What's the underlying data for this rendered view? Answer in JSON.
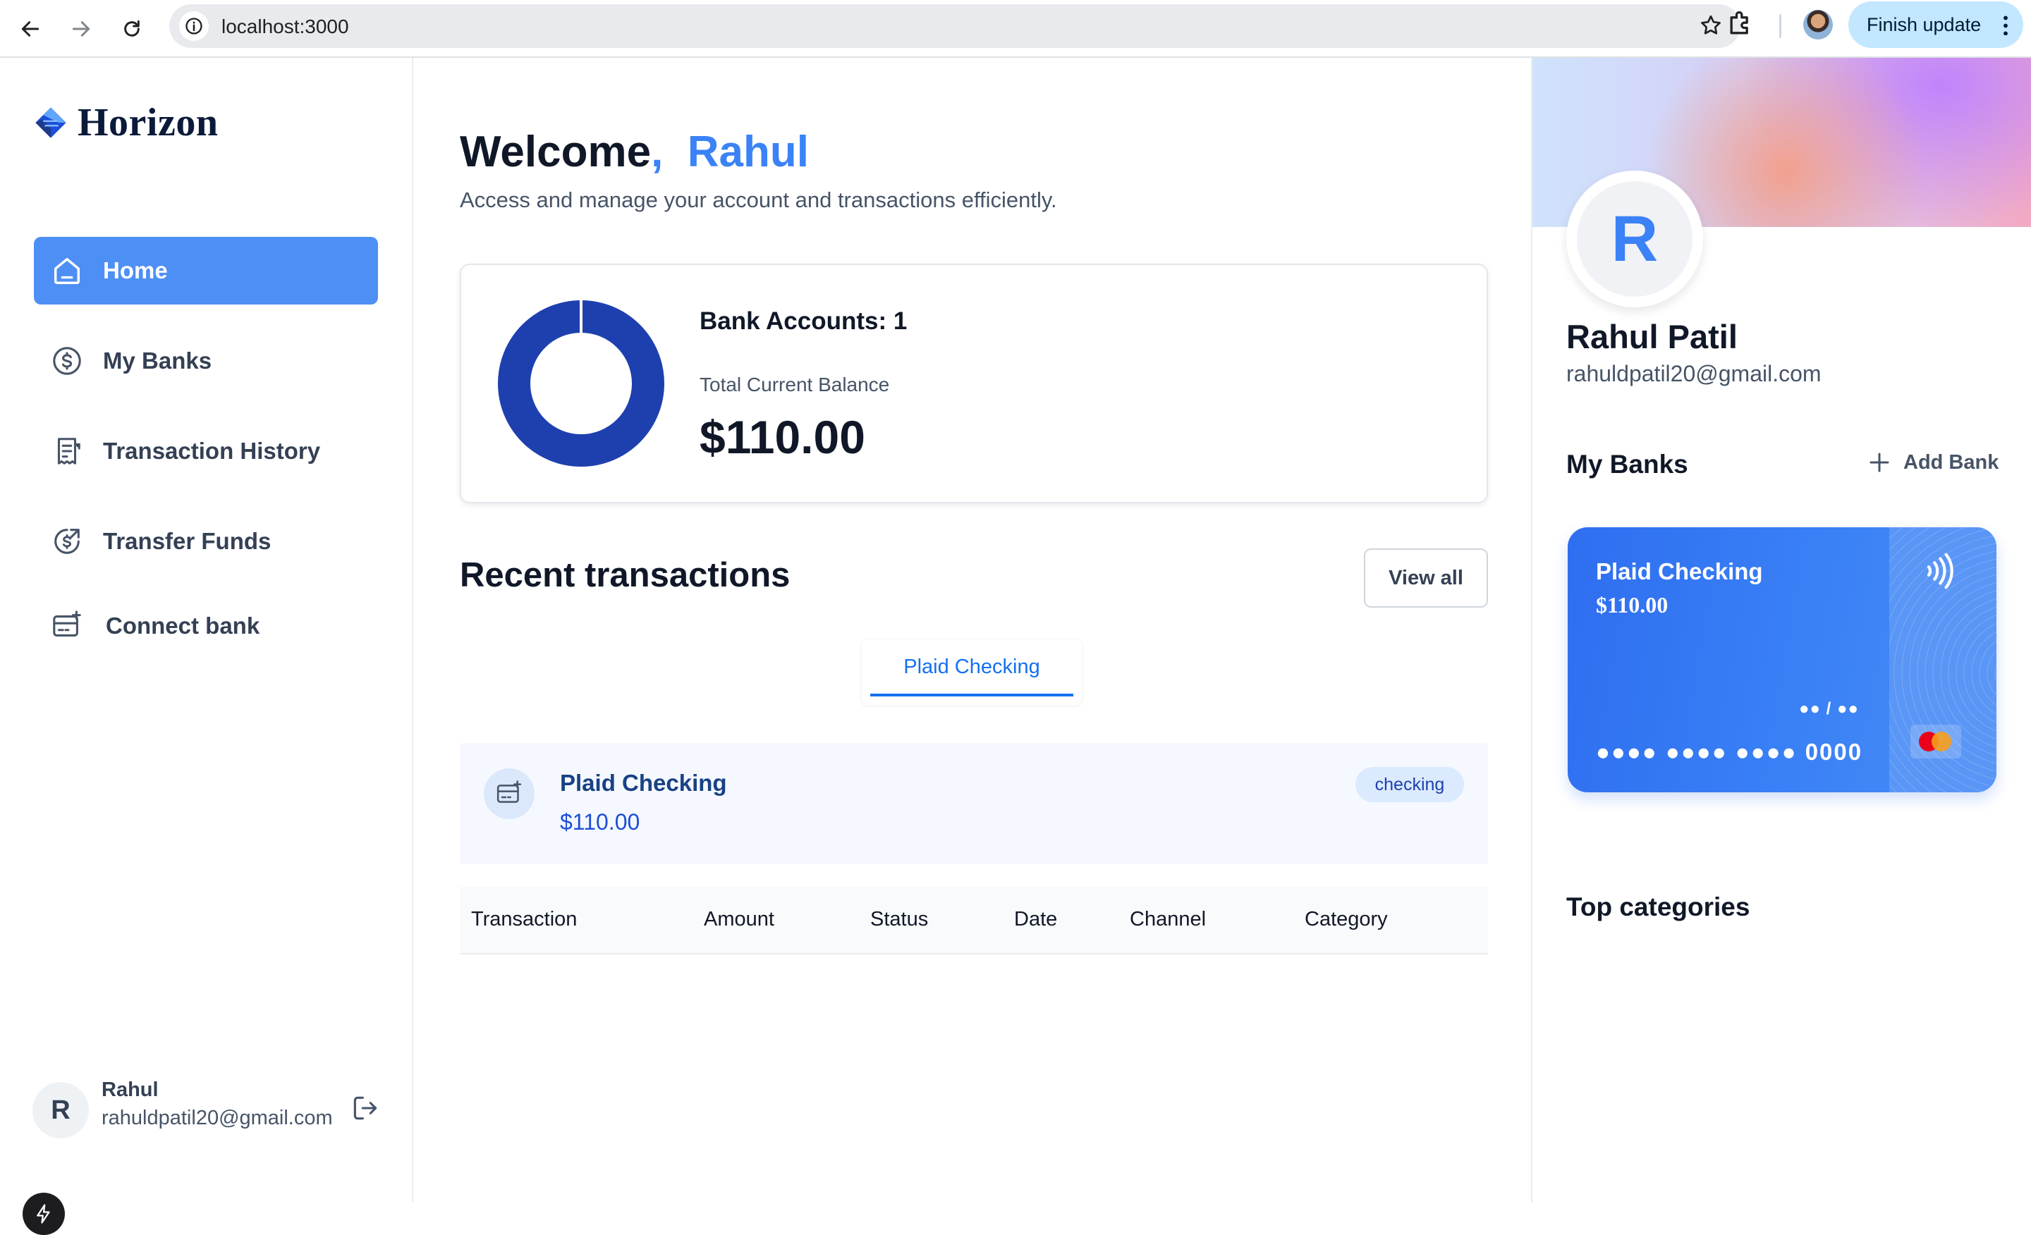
{
  "browser": {
    "url": "localhost:3000",
    "update_label": "Finish update"
  },
  "sidebar": {
    "brand": "Horizon",
    "items": [
      {
        "label": "Home",
        "icon": "home-icon",
        "active": true
      },
      {
        "label": "My Banks",
        "icon": "dollar-circle-icon",
        "active": false
      },
      {
        "label": "Transaction History",
        "icon": "receipt-icon",
        "active": false
      },
      {
        "label": "Transfer Funds",
        "icon": "money-send-icon",
        "active": false
      },
      {
        "label": "Connect bank",
        "icon": "connect-bank-icon",
        "active": false
      }
    ],
    "user": {
      "initial": "R",
      "name": "Rahul",
      "email": "rahuldpatil20@gmail.com"
    }
  },
  "main": {
    "welcome": "Welcome",
    "comma": ",",
    "user_name": "Rahul",
    "subtitle": "Access and manage your account and transactions efficiently.",
    "balance_card": {
      "bank_accounts": "Bank Accounts: 1",
      "balance_label": "Total Current Balance",
      "balance": "$110.00",
      "donut_share": 1.0
    },
    "recent_title": "Recent transactions",
    "view_all": "View all",
    "tabs": [
      {
        "label": "Plaid Checking",
        "active": true
      }
    ],
    "account": {
      "name": "Plaid Checking",
      "balance": "$110.00",
      "type": "checking"
    },
    "table_headers": [
      "Transaction",
      "Amount",
      "Status",
      "Date",
      "Channel",
      "Category"
    ]
  },
  "right": {
    "initial": "R",
    "name": "Rahul Patil",
    "email": "rahuldpatil20@gmail.com",
    "my_banks": "My Banks",
    "add_bank": "Add Bank",
    "card": {
      "name": "Plaid Checking",
      "balance": "$110.00",
      "expiry": "●● / ●●",
      "number": "●●●● ●●●● ●●●● 0000"
    },
    "top_categories": "Top categories"
  },
  "colors": {
    "accent": "#3b82f6",
    "donut": "#1e40af",
    "nav_active": "#4e8ff5"
  }
}
